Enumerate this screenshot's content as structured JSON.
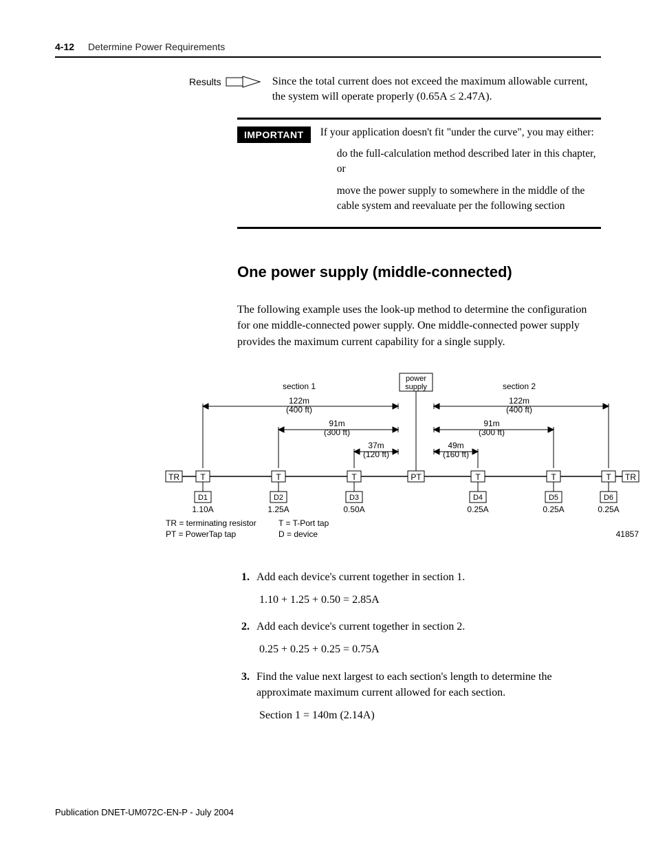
{
  "header": {
    "page_number": "4-12",
    "section_title": "Determine Power Requirements"
  },
  "results": {
    "label": "Results",
    "text": "Since the total current does not exceed the maximum allowable current, the system will operate properly (0.65A ≤ 2.47A)."
  },
  "important": {
    "badge": "IMPORTANT",
    "intro": "If your application doesn't fit \"under the curve\", you may either:",
    "bullets": [
      "do the full-calculation method described later in this chapter, or",
      "move the power supply to somewhere in the middle of the cable system and reevaluate per the following section"
    ]
  },
  "section": {
    "heading": "One power supply (middle-connected)",
    "intro": "The following example uses the look-up method to determine the configuration for one middle-connected power supply. One middle-connected power supply provides the maximum current capability for a single supply."
  },
  "diagram": {
    "labels": {
      "power_supply": "power\nsupply",
      "section1": "section 1",
      "section2": "section 2",
      "dist_122m": "122m",
      "dist_400ft": "(400 ft)",
      "dist_91m": "91m",
      "dist_300ft": "(300 ft)",
      "dist_37m": "37m",
      "dist_120ft": "(120 ft)",
      "dist_49m": "49m",
      "dist_160ft": "(160 ft)",
      "TR": "TR",
      "T": "T",
      "PT": "PT",
      "fig_id": "41857"
    },
    "devices": [
      {
        "name": "D1",
        "current": "1.10A"
      },
      {
        "name": "D2",
        "current": "1.25A"
      },
      {
        "name": "D3",
        "current": "0.50A"
      },
      {
        "name": "D4",
        "current": "0.25A"
      },
      {
        "name": "D5",
        "current": "0.25A"
      },
      {
        "name": "D6",
        "current": "0.25A"
      }
    ],
    "legend": {
      "TR": "TR = terminating resistor",
      "PT": "PT = PowerTap tap",
      "T": "T = T-Port tap",
      "D": "D = device"
    }
  },
  "steps": [
    {
      "text": "Add each device's current together in section 1.",
      "calc": "1.10 + 1.25 + 0.50 = 2.85A"
    },
    {
      "text": "Add each device's current together in section 2.",
      "calc": "0.25 + 0.25 + 0.25 = 0.75A"
    },
    {
      "text": "Find the value next largest to each section's length to determine the approximate maximum current allowed for each section.",
      "calc": "Section 1 = 140m (2.14A)"
    }
  ],
  "footer": {
    "publication": "Publication DNET-UM072C-EN-P - July 2004"
  }
}
